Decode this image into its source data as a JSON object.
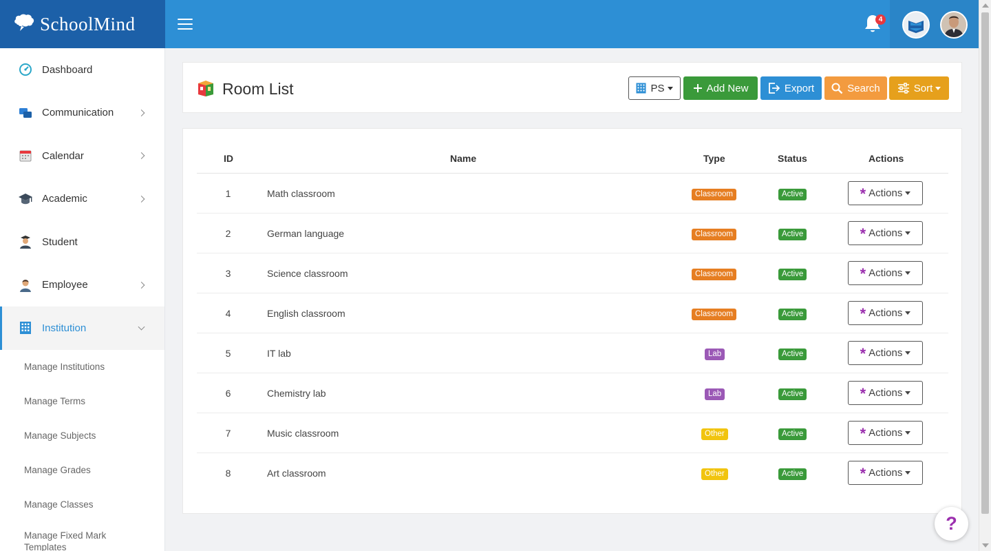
{
  "brand": {
    "name": "SchoolMind"
  },
  "topbar": {
    "notification_count": "4"
  },
  "sidebar": {
    "items": [
      {
        "label": "Dashboard",
        "icon": "dashboard-icon",
        "has_children": false
      },
      {
        "label": "Communication",
        "icon": "chat-icon",
        "has_children": true
      },
      {
        "label": "Calendar",
        "icon": "calendar-icon",
        "has_children": true
      },
      {
        "label": "Academic",
        "icon": "graduation-cap-icon",
        "has_children": true
      },
      {
        "label": "Student",
        "icon": "student-icon",
        "has_children": false
      },
      {
        "label": "Employee",
        "icon": "employee-icon",
        "has_children": true
      },
      {
        "label": "Institution",
        "icon": "building-icon",
        "has_children": true,
        "active": true
      }
    ],
    "subitems": [
      "Manage Institutions",
      "Manage Terms",
      "Manage Subjects",
      "Manage Grades",
      "Manage Classes",
      "Manage Fixed Mark Templates"
    ]
  },
  "header": {
    "title": "Room List",
    "buttons": {
      "ps": "PS",
      "add": "Add New",
      "export": "Export",
      "search": "Search",
      "sort": "Sort"
    }
  },
  "table": {
    "columns": {
      "id": "ID",
      "name": "Name",
      "type": "Type",
      "status": "Status",
      "actions": "Actions"
    },
    "rows": [
      {
        "id": "1",
        "name": "Math classroom",
        "type": "Classroom",
        "status": "Active",
        "action": "Actions"
      },
      {
        "id": "2",
        "name": "German language",
        "type": "Classroom",
        "status": "Active",
        "action": "Actions"
      },
      {
        "id": "3",
        "name": "Science classroom",
        "type": "Classroom",
        "status": "Active",
        "action": "Actions"
      },
      {
        "id": "4",
        "name": "English classroom",
        "type": "Classroom",
        "status": "Active",
        "action": "Actions"
      },
      {
        "id": "5",
        "name": "IT lab",
        "type": "Lab",
        "status": "Active",
        "action": "Actions"
      },
      {
        "id": "6",
        "name": "Chemistry lab",
        "type": "Lab",
        "status": "Active",
        "action": "Actions"
      },
      {
        "id": "7",
        "name": "Music classroom",
        "type": "Other",
        "status": "Active",
        "action": "Actions"
      },
      {
        "id": "8",
        "name": "Art classroom",
        "type": "Other",
        "status": "Active",
        "action": "Actions"
      }
    ]
  },
  "colors": {
    "topbar": "#2d8fd5",
    "brand_bg": "#1c60a8",
    "classroom": "#e67e22",
    "lab": "#9b59b6",
    "other": "#f1c40f",
    "active": "#3a9a3a"
  },
  "help": {
    "label": "?"
  }
}
